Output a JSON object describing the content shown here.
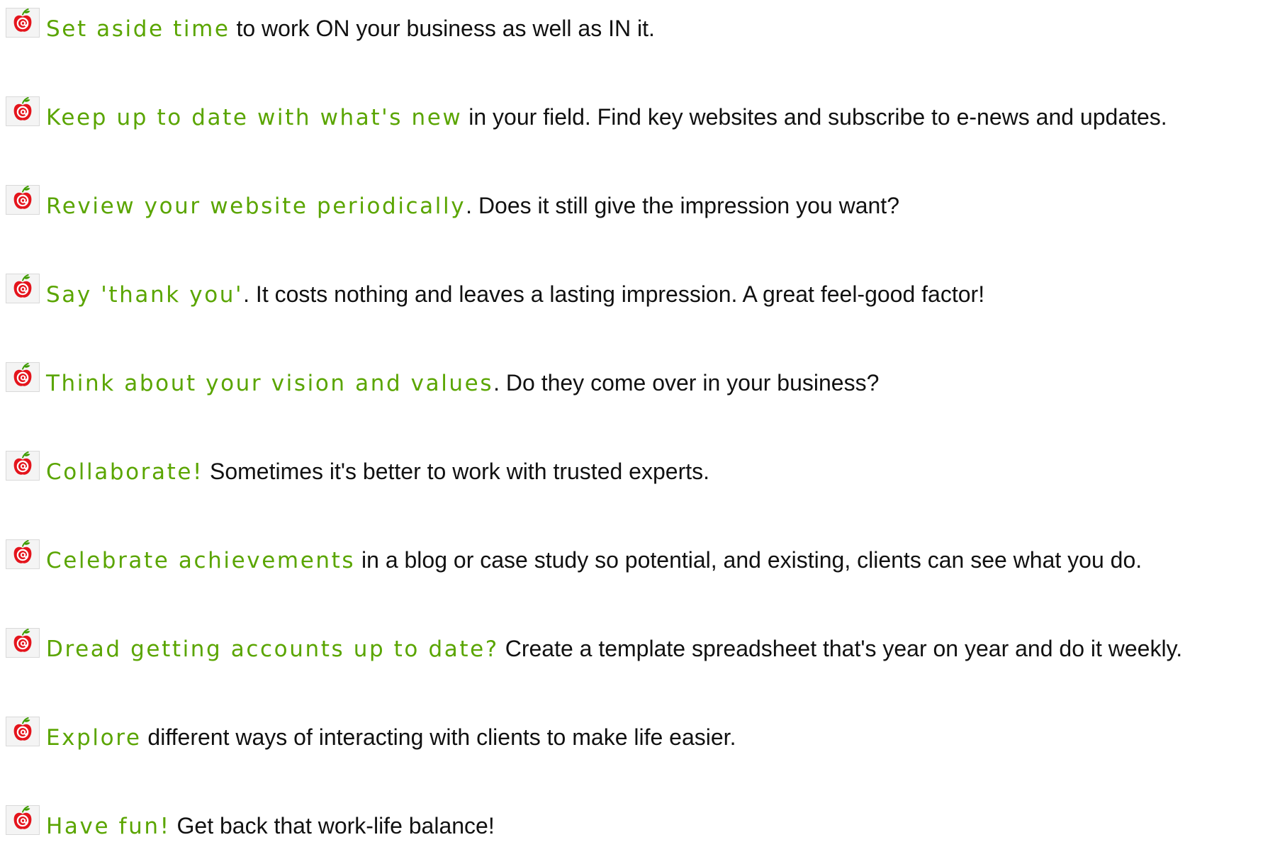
{
  "colors": {
    "highlight": "#5aa500",
    "body_text": "#111111",
    "icon_apple_red": "#e4141c",
    "icon_leaf_green": "#3f9b00"
  },
  "bullet_icon": "apple-at-icon",
  "tips": [
    {
      "highlight": "Set aside time",
      "rest": " to work ON your business as well as IN it."
    },
    {
      "highlight": "Keep up to date with what's new",
      "rest": " in your field. Find key websites and subscribe to e-news and updates."
    },
    {
      "highlight": "Review your website periodically",
      "rest": ". Does it still give the impression you want?"
    },
    {
      "highlight": "Say 'thank you'",
      "rest": ". It costs nothing and leaves a lasting impression. A great feel-good factor!"
    },
    {
      "highlight": "Think about your vision and values",
      "rest": ". Do they come over in your business?"
    },
    {
      "highlight": "Collaborate!",
      "rest": " Sometimes it's better to work with trusted experts."
    },
    {
      "highlight": "Celebrate achievements",
      "rest": " in a blog or case study so potential, and existing, clients can see what you do."
    },
    {
      "highlight": "Dread getting accounts up to date?",
      "rest": " Create a template spreadsheet that's year on year and do it weekly."
    },
    {
      "highlight": "Explore",
      "rest": " different ways of interacting with clients to make life easier."
    },
    {
      "highlight": "Have fun!",
      "rest": " Get back that work-life balance!"
    }
  ]
}
